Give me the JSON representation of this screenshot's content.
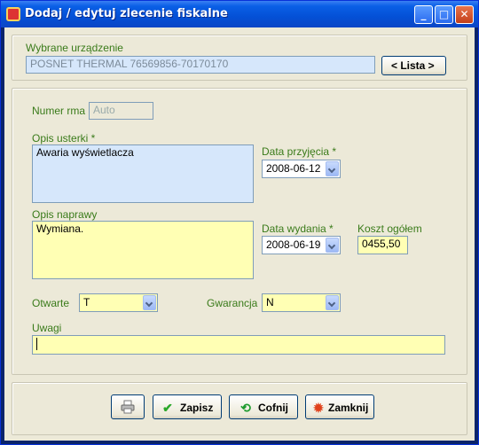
{
  "window": {
    "title": "Dodaj / edytuj zlecenie fiskalne"
  },
  "device": {
    "label": "Wybrane urządzenie",
    "value": "POSNET THERMAL 76569856-70170170",
    "list_button": "< Lista >"
  },
  "form": {
    "numer_rma": {
      "label": "Numer rma",
      "value": "Auto"
    },
    "opis_usterki": {
      "label": "Opis usterki *",
      "value": "Awaria wyświetlacza"
    },
    "data_przyjecia": {
      "label": "Data przyjęcia *",
      "value": "2008-06-12"
    },
    "opis_naprawy": {
      "label": "Opis naprawy",
      "value": "Wymiana."
    },
    "data_wydania": {
      "label": "Data wydania *",
      "value": "2008-06-19"
    },
    "koszt": {
      "label": "Koszt ogółem",
      "value": "0455,50"
    },
    "otwarte": {
      "label": "Otwarte",
      "value": "T"
    },
    "gwarancja": {
      "label": "Gwarancja",
      "value": "N"
    },
    "uwagi": {
      "label": "Uwagi",
      "value": ""
    }
  },
  "buttons": {
    "save": "Zapisz",
    "undo": "Cofnij",
    "close": "Zamknij"
  },
  "icons": {
    "print": "printer-icon",
    "save": "check-icon",
    "undo": "refresh-icon",
    "close": "stop-icon"
  },
  "colors": {
    "label_green": "#3a7b1a",
    "field_blue": "#d6e7fb",
    "field_yellow": "#ffffb4",
    "titlebar_blue": "#0450d6"
  }
}
